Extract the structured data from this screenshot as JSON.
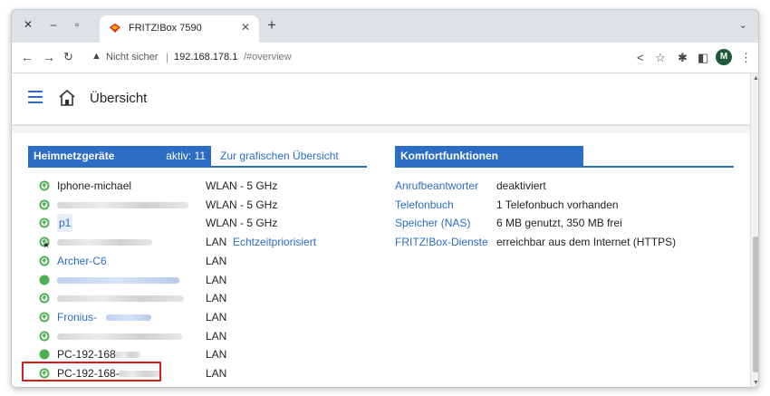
{
  "browser": {
    "tab_title": "FRITZ!Box 7590",
    "security_label": "Nicht sicher",
    "url_host": "192.168.178.1",
    "url_path": "/#overview",
    "profile_initial": "M"
  },
  "header": {
    "title": "Übersicht"
  },
  "heimnetz": {
    "title": "Heimnetzgeräte",
    "active_label": "aktiv: 11",
    "graph_link": "Zur grafischen Übersicht",
    "devices": [
      {
        "name": "Iphone-michael",
        "connection": "WLAN - 5 GHz",
        "extra": "",
        "icon": "globe-icon",
        "link": false
      },
      {
        "name": "",
        "connection": "WLAN - 5 GHz",
        "extra": "",
        "icon": "globe-icon",
        "link": false
      },
      {
        "name": "p1",
        "connection": "WLAN - 5 GHz",
        "extra": "",
        "icon": "globe-icon",
        "link": true
      },
      {
        "name": "",
        "connection": "LAN",
        "extra": "Echtzeitpriorisiert",
        "icon": "star-globe-icon",
        "link": false
      },
      {
        "name": "Archer-C6",
        "connection": "LAN",
        "extra": "",
        "icon": "globe-icon",
        "link": true
      },
      {
        "name": "",
        "connection": "LAN",
        "extra": "",
        "icon": "status-dot-icon",
        "link": true
      },
      {
        "name": "",
        "connection": "LAN",
        "extra": "",
        "icon": "globe-icon",
        "link": false
      },
      {
        "name": "Fronius-",
        "connection": "LAN",
        "extra": "",
        "icon": "globe-icon",
        "link": true
      },
      {
        "name": "",
        "connection": "LAN",
        "extra": "",
        "icon": "globe-icon",
        "link": false
      },
      {
        "name": "PC-192-168",
        "connection": "LAN",
        "extra": "",
        "icon": "status-dot-icon",
        "link": false
      },
      {
        "name": "PC-192-168-",
        "connection": "LAN",
        "extra": "",
        "icon": "globe-icon",
        "link": false
      }
    ]
  },
  "komfort": {
    "title": "Komfortfunktionen",
    "items": [
      {
        "label": "Anrufbeantworter",
        "value": "deaktiviert"
      },
      {
        "label": "Telefonbuch",
        "value": "1 Telefonbuch vorhanden"
      },
      {
        "label": "Speicher (NAS)",
        "value": "6 MB genutzt, 350 MB frei"
      },
      {
        "label": "FRITZ!Box-Dienste",
        "value": "erreichbar aus dem Internet (HTTPS)"
      }
    ]
  },
  "colors": {
    "accent": "#2b6cc4",
    "status_green": "#4caf50",
    "highlight_red": "#d21e1e"
  }
}
